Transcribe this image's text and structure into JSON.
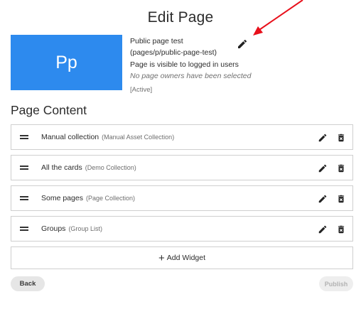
{
  "page": {
    "title": "Edit Page"
  },
  "thumbnail": {
    "initials": "Pp",
    "color": "#2d8aee"
  },
  "details": {
    "name": "Public page test",
    "path": "(pages/p/public-page-test)",
    "visibility": "Page is visible to logged in users",
    "owners": "No page owners have been selected",
    "status": "[Active]",
    "edit_icon": "pencil-icon"
  },
  "annotation": {
    "color": "#e8101b"
  },
  "content": {
    "heading": "Page Content",
    "widgets": [
      {
        "name": "Manual collection",
        "type": "(Manual Asset Collection)"
      },
      {
        "name": "All the cards",
        "type": "(Demo Collection)"
      },
      {
        "name": "Some pages",
        "type": "(Page Collection)"
      },
      {
        "name": "Groups",
        "type": "(Group List)"
      }
    ],
    "add_widget_label": "Add Widget"
  },
  "actions": {
    "back_label": "Back",
    "publish_label": "Publish"
  }
}
